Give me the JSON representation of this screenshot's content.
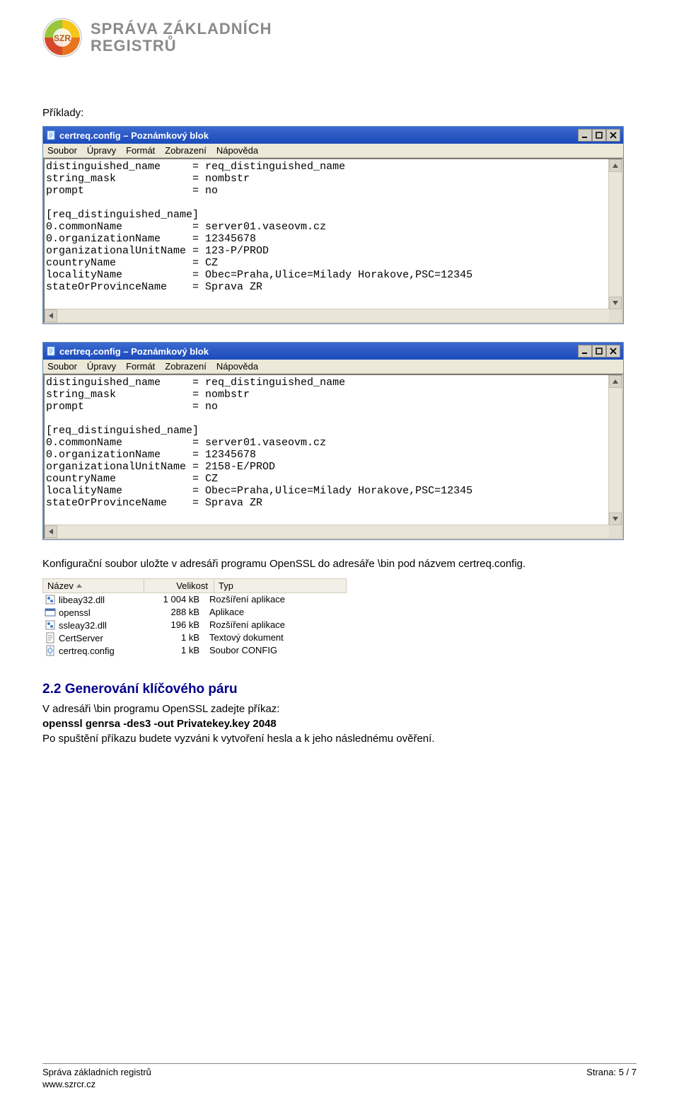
{
  "header": {
    "line1": "SPRÁVA ZÁKLADNÍCH",
    "line2": "REGISTRŮ"
  },
  "priklady_label": "Příklady:",
  "window": {
    "title": "certreq.config – Poznámkový blok",
    "menu": [
      "Soubor",
      "Úpravy",
      "Formát",
      "Zobrazení",
      "Nápověda"
    ]
  },
  "notepad1_lines": [
    "distinguished_name     = req_distinguished_name",
    "string_mask            = nombstr",
    "prompt                 = no",
    "",
    "[req_distinguished_name]",
    "0.commonName           = server01.vaseovm.cz",
    "0.organizationName     = 12345678",
    "organizationalUnitName = 123-P/PROD",
    "countryName            = CZ",
    "localityName           = Obec=Praha,Ulice=Milady Horakove,PSC=12345",
    "stateOrProvinceName    = Sprava ZR"
  ],
  "notepad2_lines": [
    "distinguished_name     = req_distinguished_name",
    "string_mask            = nombstr",
    "prompt                 = no",
    "",
    "[req_distinguished_name]",
    "0.commonName           = server01.vaseovm.cz",
    "0.organizationName     = 12345678",
    "organizationalUnitName = 2158-E/PROD",
    "countryName            = CZ",
    "localityName           = Obec=Praha,Ulice=Milady Horakove,PSC=12345",
    "stateOrProvinceName    = Sprava ZR"
  ],
  "para_save": "Konfigurační soubor uložte v adresáři programu OpenSSL do adresáře \\bin pod názvem certreq.config.",
  "explorer": {
    "cols": [
      "Název",
      "Velikost",
      "Typ"
    ],
    "rows": [
      {
        "icon": "dll",
        "name": "libeay32.dll",
        "size": "1 004 kB",
        "type": "Rozšíření aplikace"
      },
      {
        "icon": "exe",
        "name": "openssl",
        "size": "288 kB",
        "type": "Aplikace"
      },
      {
        "icon": "dll",
        "name": "ssleay32.dll",
        "size": "196 kB",
        "type": "Rozšíření aplikace"
      },
      {
        "icon": "txt",
        "name": "CertServer",
        "size": "1 kB",
        "type": "Textový dokument"
      },
      {
        "icon": "cfg",
        "name": "certreq.config",
        "size": "1 kB",
        "type": "Soubor CONFIG"
      }
    ]
  },
  "section_2_2": "2.2  Generování klíčového páru",
  "para_gen_1": "V adresáři \\bin programu OpenSSL zadejte příkaz:",
  "cmd": "openssl genrsa -des3 -out Privatekey.key 2048",
  "para_gen_2": "Po spuštění příkazu budete vyzváni k vytvoření hesla a k jeho následnému ověření.",
  "footer": {
    "l1": "Správa základních registrů",
    "l2": "www.szrcr.cz",
    "r": "Strana: 5 / 7"
  }
}
